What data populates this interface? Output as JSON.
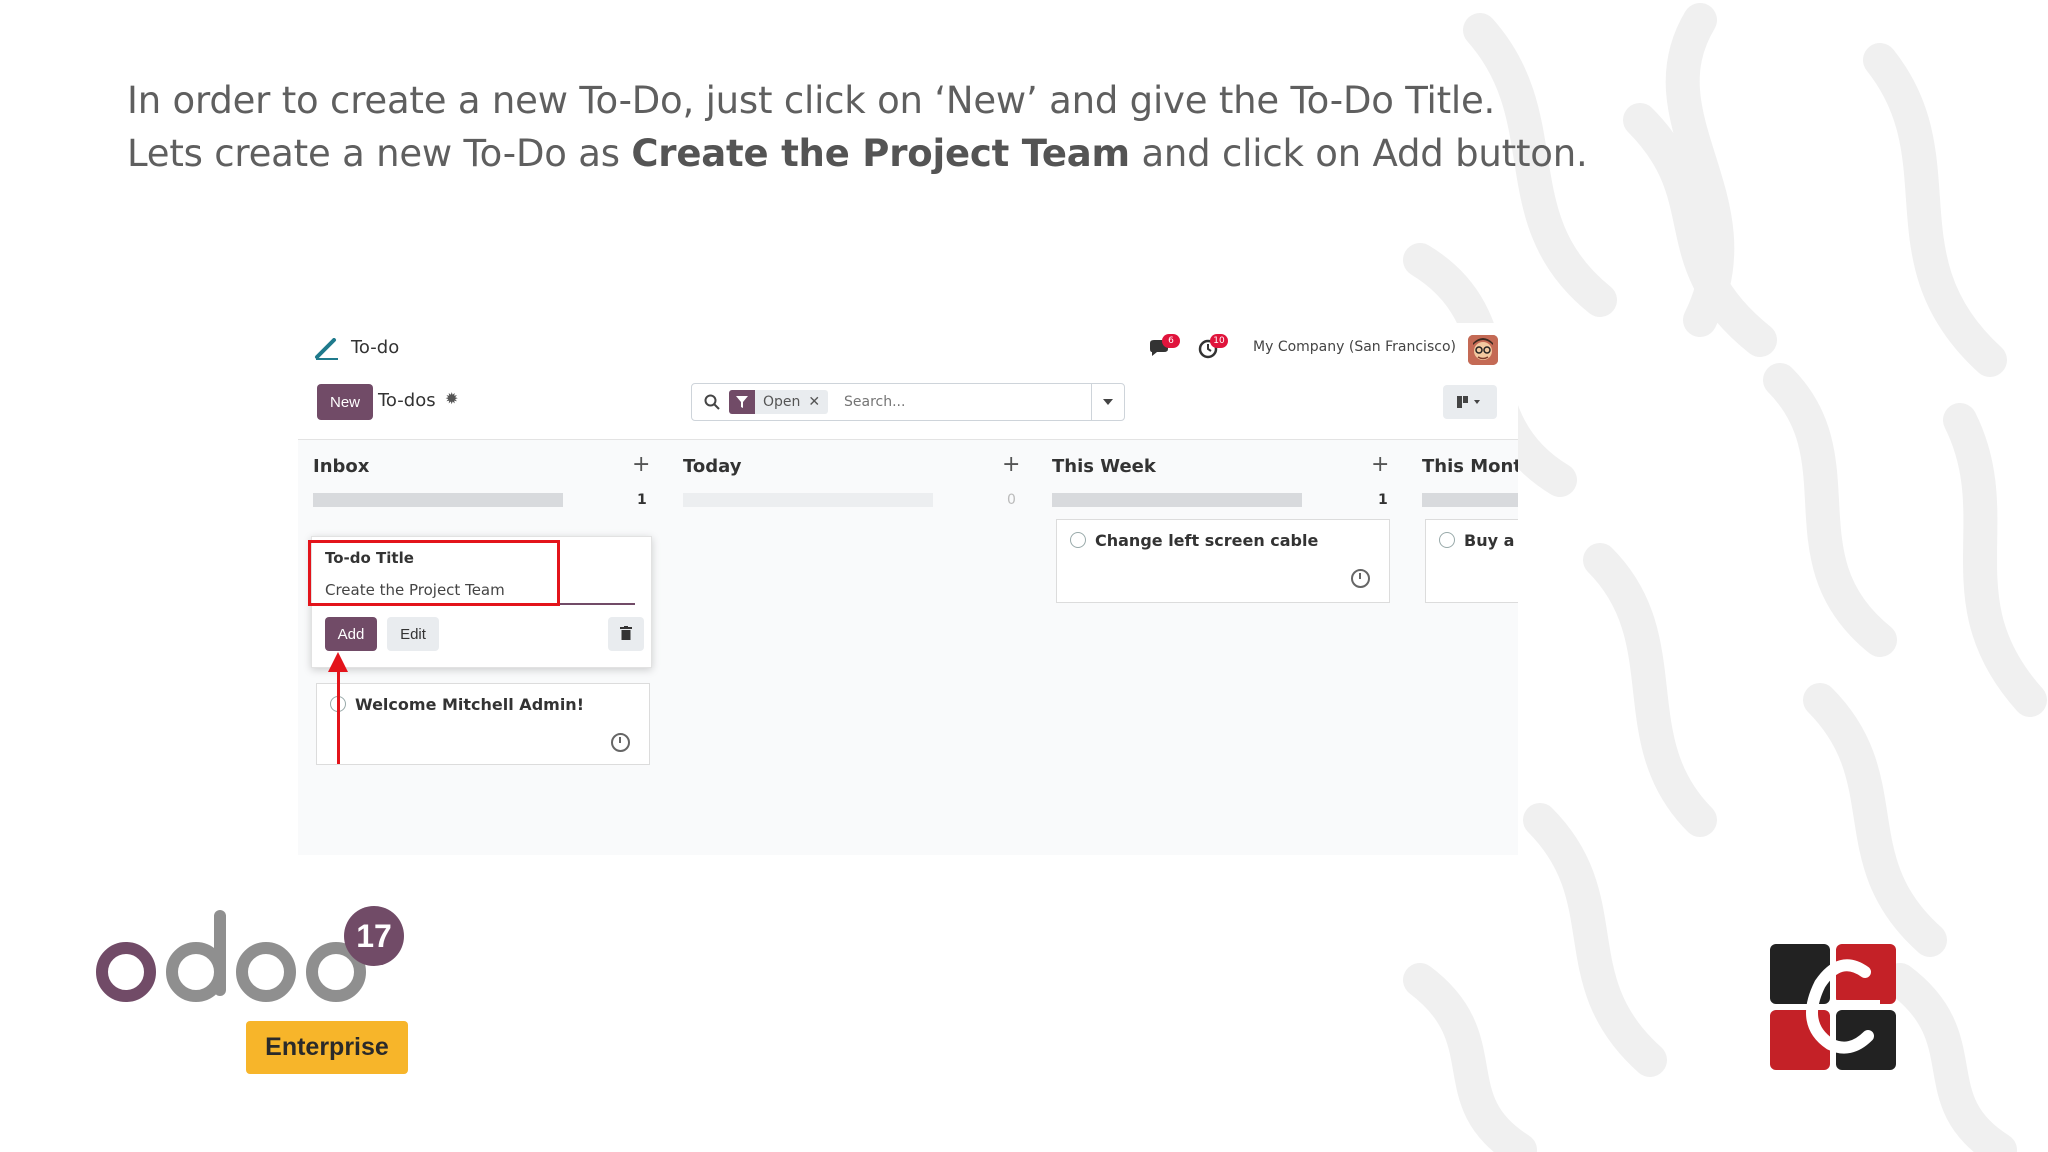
{
  "caption": {
    "line1": "In order to create a new To-Do, just click on ‘New’ and give the To-Do Title.",
    "line2_pre": "Lets create a new To-Do as ",
    "line2_bold": "Create the Project Team",
    "line2_post": " and click on Add button."
  },
  "app": {
    "name": "To-do",
    "messages_badge": "6",
    "activities_badge": "10",
    "company": "My Company (San Francisco)"
  },
  "controls": {
    "new_label": "New",
    "breadcrumb": "To-dos",
    "facet_value": "Open",
    "search_placeholder": "Search..."
  },
  "columns": [
    {
      "title": "Inbox",
      "count": "1"
    },
    {
      "title": "Today",
      "count": "0"
    },
    {
      "title": "This Week",
      "count": "1"
    },
    {
      "title": "This Month",
      "count": ""
    }
  ],
  "quick_create": {
    "label": "To-do Title",
    "value": "Create the Project Team",
    "add_label": "Add",
    "edit_label": "Edit"
  },
  "cards": {
    "inbox_card": "Welcome Mitchell Admin!",
    "week_card": "Change left screen cable",
    "month_card": "Buy a g"
  },
  "logo": {
    "odoo_text": "odoo",
    "version": "17",
    "edition": "Enterprise"
  },
  "colors": {
    "primary": "#714b67",
    "highlight": "#e3141b",
    "enterprise": "#f7b52a"
  }
}
